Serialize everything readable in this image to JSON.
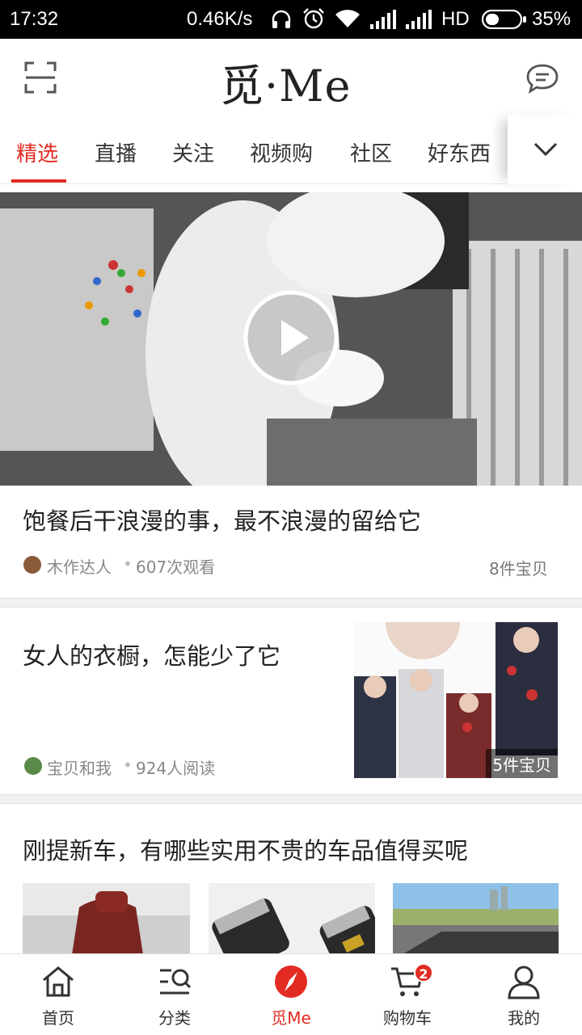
{
  "status_bar": {
    "time": "17:32",
    "speed": "0.46K/s",
    "network": "HD",
    "battery": "35%",
    "icons": [
      "headphones-icon",
      "alarm-icon",
      "wifi-icon",
      "signal-icon",
      "signal-icon",
      "battery-icon"
    ]
  },
  "header": {
    "logo": "觅·Me",
    "scan_icon": "scan-icon",
    "message_icon": "chat-bubble-icon"
  },
  "tabs": {
    "items": [
      "精选",
      "直播",
      "关注",
      "视频购",
      "社区",
      "好东西"
    ],
    "active_index": 0,
    "more_icon": "chevron-down-icon"
  },
  "feed": {
    "video_card": {
      "title": "饱餐后干浪漫的事，最不浪漫的留给它",
      "author": "木作达人",
      "stat": "607次观看",
      "items_count": "8件宝贝",
      "play_icon": "play-icon"
    },
    "article_card": {
      "title": "女人的衣橱，怎能少了它",
      "author": "宝贝和我",
      "stat": "924人阅读",
      "items_count": "5件宝贝"
    },
    "list_card": {
      "title": "刚提新车，有哪些实用不贵的车品值得买呢"
    }
  },
  "bottom_nav": {
    "items": [
      {
        "label": "首页",
        "icon": "home-icon"
      },
      {
        "label": "分类",
        "icon": "category-search-icon"
      },
      {
        "label": "觅Me",
        "icon": "compass-icon"
      },
      {
        "label": "购物车",
        "icon": "cart-icon"
      },
      {
        "label": "我的",
        "icon": "person-icon"
      }
    ],
    "active_index": 2,
    "cart_badge": "2"
  },
  "colors": {
    "accent": "#e22b22",
    "text": "#222222",
    "meta": "#888888",
    "divider": "#f1f1f1"
  }
}
